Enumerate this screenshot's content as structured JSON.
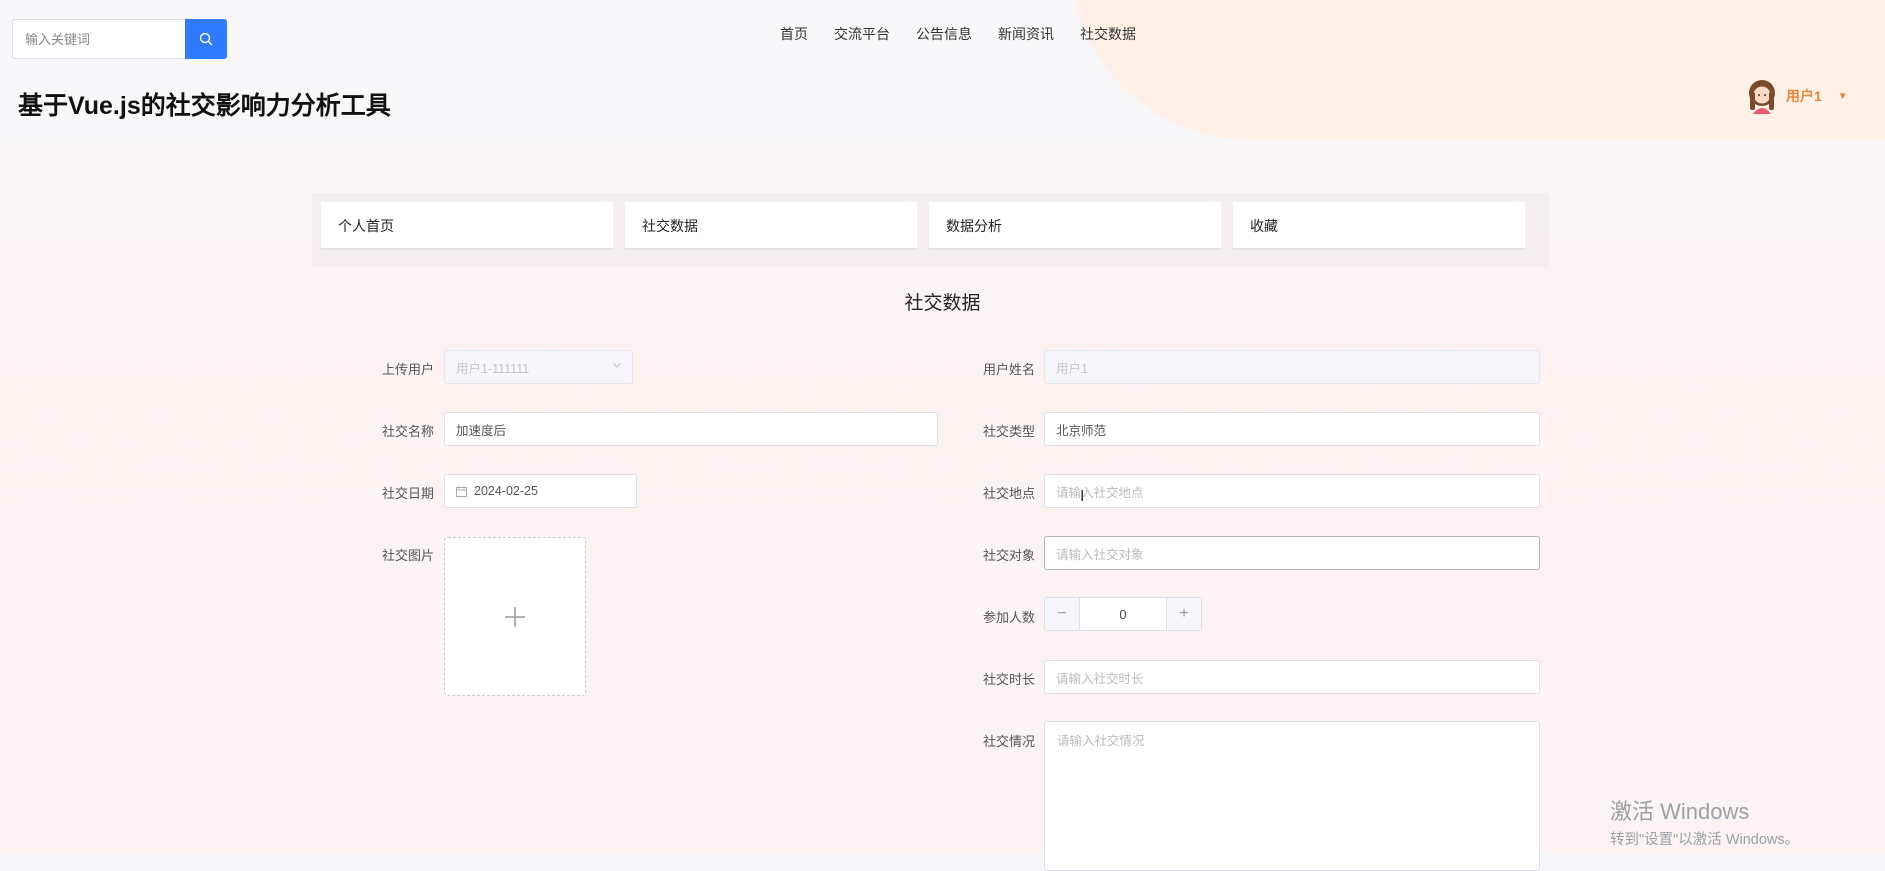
{
  "header": {
    "search": {
      "placeholder": "输入关键词"
    },
    "nav": [
      "首页",
      "交流平台",
      "公告信息",
      "新闻资讯",
      "社交数据"
    ],
    "site_title": "基于Vue.js的社交影响力分析工具",
    "user": {
      "name": "用户1"
    }
  },
  "tabs": [
    "个人首页",
    "社交数据",
    "数据分析",
    "收藏"
  ],
  "form": {
    "title": "社交数据",
    "upload_user": {
      "label": "上传用户",
      "value": "用户1-111111"
    },
    "user_name": {
      "label": "用户姓名",
      "value": "用户1"
    },
    "social_name": {
      "label": "社交名称",
      "value": "加速度后"
    },
    "social_type": {
      "label": "社交类型",
      "value": "北京师范"
    },
    "social_date": {
      "label": "社交日期",
      "value": "2024-02-25"
    },
    "social_place": {
      "label": "社交地点",
      "placeholder": "请输入社交地点"
    },
    "social_image": {
      "label": "社交图片"
    },
    "social_target": {
      "label": "社交对象",
      "placeholder": "请输入社交对象"
    },
    "participants": {
      "label": "参加人数",
      "value": "0"
    },
    "duration": {
      "label": "社交时长",
      "placeholder": "请输入社交时长"
    },
    "situation": {
      "label": "社交情况",
      "placeholder": "请输入社交情况"
    }
  },
  "watermark": {
    "title": "激活 Windows",
    "subtitle": "转到\"设置\"以激活 Windows。"
  },
  "colors": {
    "accent": "#2f7bff",
    "user_name": "#e8863a"
  }
}
